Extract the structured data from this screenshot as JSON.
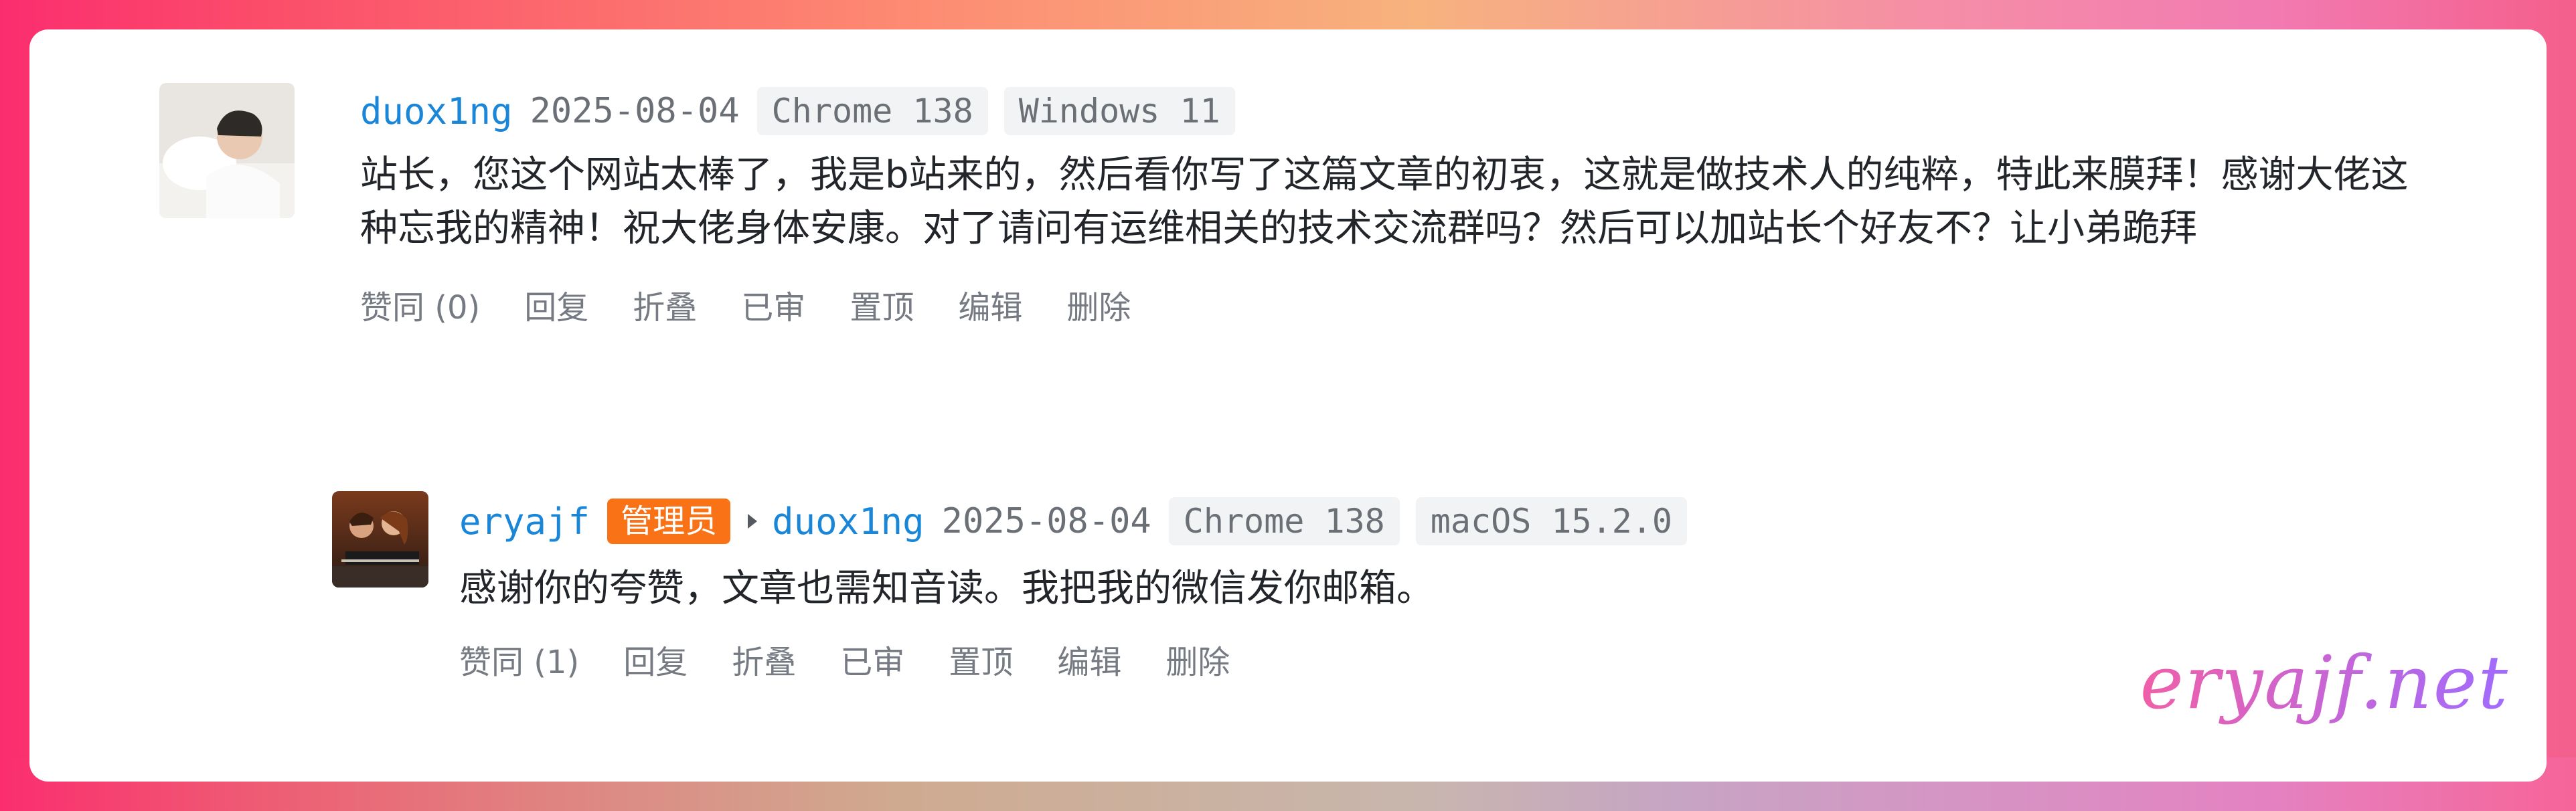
{
  "comments": [
    {
      "username": "duox1ng",
      "date": "2025-08-04",
      "browser": "Chrome 138",
      "os": "Windows 11",
      "text": "站长，您这个网站太棒了，我是b站来的，然后看你写了这篇文章的初衷，这就是做技术人的纯粹，特此来膜拜！感谢大佬这种忘我的精神！祝大佬身体安康。对了请问有运维相关的技术交流群吗？然后可以加站长个好友不？让小弟跪拜",
      "actions": [
        "赞同 (0)",
        "回复",
        "折叠",
        "已审",
        "置顶",
        "编辑",
        "删除"
      ]
    }
  ],
  "reply": {
    "username": "eryajf",
    "badge": "管理员",
    "reply_to": "duox1ng",
    "date": "2025-08-04",
    "browser": "Chrome 138",
    "os": "macOS 15.2.0",
    "text": "感谢你的夸赞，文章也需知音读。我把我的微信发你邮箱。",
    "actions": [
      "赞同 (1)",
      "回复",
      "折叠",
      "已审",
      "置顶",
      "编辑",
      "删除"
    ]
  },
  "watermark": "eryajf.net",
  "colors": {
    "username": "#1a86d8",
    "badge": "#f97316"
  }
}
